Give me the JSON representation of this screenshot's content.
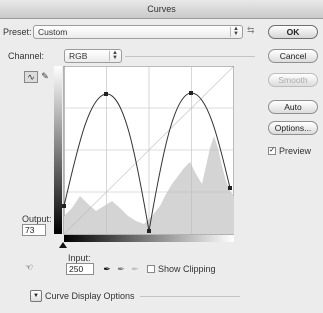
{
  "window": {
    "title": "Curves"
  },
  "preset": {
    "label": "Preset:",
    "value": "Custom"
  },
  "channel": {
    "label": "Channel:",
    "value": "RGB"
  },
  "buttons": {
    "ok": "OK",
    "cancel": "Cancel",
    "smooth": "Smooth",
    "auto": "Auto",
    "options": "Options..."
  },
  "preview": {
    "label": "Preview",
    "checked": true
  },
  "output": {
    "label": "Output:",
    "value": "73"
  },
  "input": {
    "label": "Input:",
    "value": "250"
  },
  "show_clipping": {
    "label": "Show Clipping",
    "checked": false
  },
  "curve_display_options": {
    "label": "Curve Display Options"
  },
  "icons": {
    "preset_menu": "preset-options-icon",
    "curve_tool": "curve-point-tool-icon",
    "pencil_tool": "pencil-tool-icon",
    "hand_tool": "targeted-adjustment-icon",
    "black_eyedropper": "black-eyedropper-icon",
    "gray_eyedropper": "gray-eyedropper-icon",
    "white_eyedropper": "white-eyedropper-icon",
    "expand": "expand-arrow-icon"
  },
  "colors": {
    "graph_bg": "#ffffff",
    "histogram": "#d3d3d3",
    "curve": "#333333",
    "grid": "#bcbcbc"
  }
}
